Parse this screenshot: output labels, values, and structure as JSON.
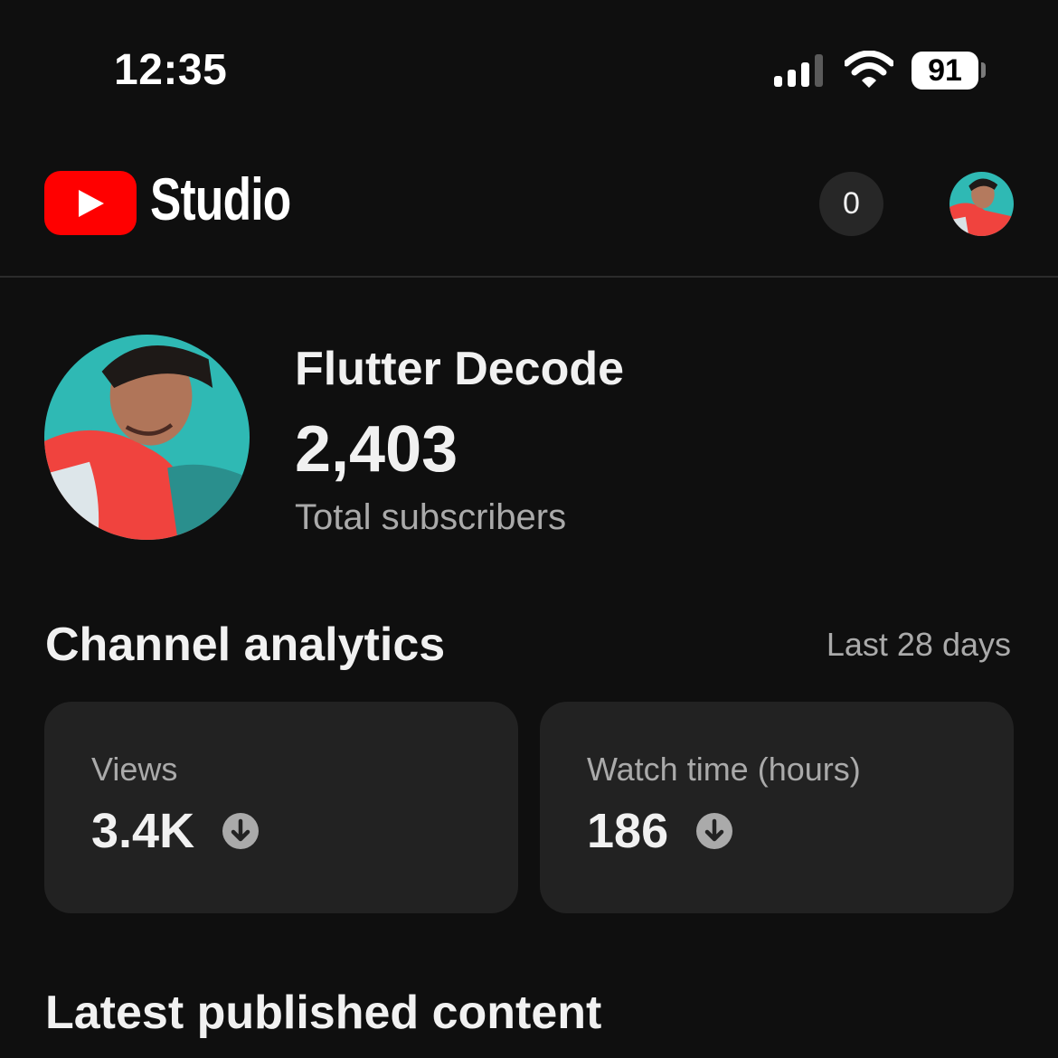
{
  "status_bar": {
    "time": "12:35",
    "battery": "91"
  },
  "header": {
    "brand": "Studio",
    "notification_count": "0"
  },
  "channel": {
    "name": "Flutter Decode",
    "subscribers": "2,403",
    "subscribers_label": "Total subscribers"
  },
  "analytics": {
    "title": "Channel analytics",
    "period": "Last 28 days",
    "cards": [
      {
        "label": "Views",
        "value": "3.4K",
        "trend": "down"
      },
      {
        "label": "Watch time (hours)",
        "value": "186",
        "trend": "down"
      }
    ]
  },
  "latest": {
    "title": "Latest published content"
  },
  "colors": {
    "background": "#0f0f0f",
    "card": "#222222",
    "brand_red": "#ff0000",
    "secondary_text": "#aaaaaa"
  },
  "icons": [
    "signal-icon",
    "wifi-icon",
    "battery-icon",
    "youtube-logo-icon",
    "trend-down-icon"
  ]
}
